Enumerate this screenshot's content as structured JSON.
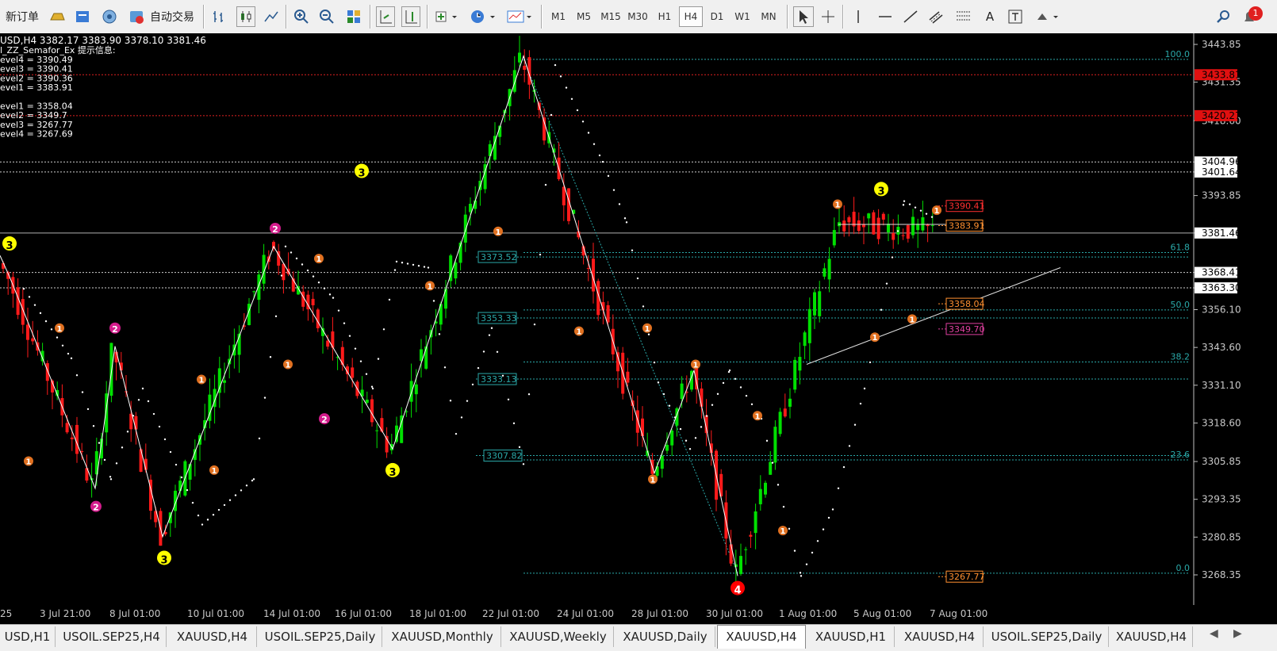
{
  "toolbar": {
    "new_order_label": "新订单",
    "auto_trading_label": "自动交易",
    "timeframes": [
      "M1",
      "M5",
      "M15",
      "M30",
      "H1",
      "H4",
      "D1",
      "W1",
      "MN"
    ],
    "active_timeframe": "H4",
    "notification_count": "1"
  },
  "chart": {
    "header": "USD,H4  3382.17 3383.90 3378.10 3381.46",
    "indicator_title": "l_ZZ_Semafor_Ex 提示信息:",
    "info_lines": [
      "evel4 = 3390.49",
      "evel3 = 3390.41",
      "evel2 = 3390.36",
      "evel1 = 3383.91",
      "",
      "evel1 = 3358.04",
      "evel2 = 3349.7",
      "evel3 = 3267.77",
      "evel4 = 3267.69"
    ],
    "price_axis": [
      "3443.85",
      "3431.35",
      "3418.60",
      "3404.96",
      "3401.64",
      "3393.85",
      "3381.46",
      "3368.41",
      "3363.30",
      "3356.10",
      "3343.60",
      "3331.10",
      "3318.60",
      "3305.85",
      "3293.35",
      "3280.85",
      "3268.35"
    ],
    "price_markers": [
      "3433.81",
      "3420.27"
    ],
    "current_price": "3381.46",
    "time_axis": [
      "25",
      "3 Jul 21:00",
      "8 Jul 01:00",
      "10 Jul 01:00",
      "14 Jul 01:00",
      "16 Jul 01:00",
      "18 Jul 01:00",
      "22 Jul 01:00",
      "24 Jul 01:00",
      "28 Jul 01:00",
      "30 Jul 01:00",
      "1 Aug 01:00",
      "5 Aug 01:00",
      "7 Aug 01:00"
    ],
    "fib_levels": [
      "100.0",
      "61.8",
      "50.0",
      "38.2",
      "23.6",
      "0.0"
    ],
    "fib_price_labels": [
      "3373.52",
      "3353.33",
      "3333.13",
      "3307.82"
    ],
    "right_labels": [
      "3390.41",
      "3383.91",
      "3358.04",
      "3349.70",
      "3267.77"
    ],
    "colors": {
      "bull": "#00e000",
      "bear": "#ff1a1a",
      "fib": "#2aa9a9",
      "semafor3": "#ffff00",
      "semafor2": "#d41c8c",
      "semafor1": "#e07020",
      "semafor4": "#ff0000"
    }
  },
  "tabs": {
    "items": [
      "USD,H1",
      "USOIL.SEP25,H4",
      "XAUUSD,H4",
      "USOIL.SEP25,Daily",
      "XAUUSD,Monthly",
      "XAUUSD,Weekly",
      "XAUUSD,Daily",
      "XAUUSD,H4",
      "XAUUSD,H1",
      "XAUUSD,H4",
      "USOIL.SEP25,Daily",
      "XAUUSD,H4"
    ],
    "active_index": 7
  }
}
